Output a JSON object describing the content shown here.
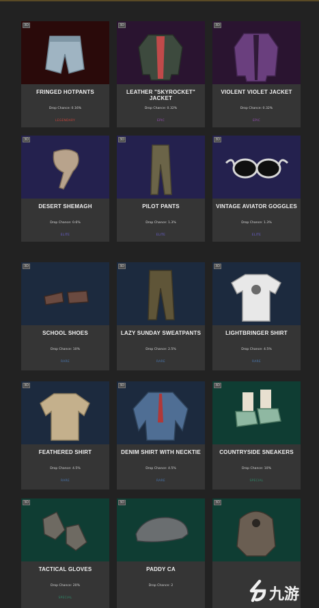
{
  "page": {
    "badge_text": "3D",
    "drop_label": "Drop Chance:"
  },
  "items": [
    {
      "name": "FRINGED HOTPANTS",
      "drop": "0.16%",
      "rarity": "LEGENDARY",
      "rarity_color": "#c8433a",
      "bg": "#2a0a0a",
      "icon": "hotpants-icon"
    },
    {
      "name": "LEATHER \"SKYROCKET\" JACKET",
      "drop": "0.32%",
      "rarity": "EPIC",
      "rarity_color": "#9a4fb8",
      "bg": "#2a1430",
      "icon": "leather-jacket-icon"
    },
    {
      "name": "VIOLENT VIOLET JACKET",
      "drop": "0.32%",
      "rarity": "EPIC",
      "rarity_color": "#9a4fb8",
      "bg": "#2a1430",
      "icon": "violet-jacket-icon"
    },
    {
      "name": "DESERT SHEMAGH",
      "drop": "0.6%",
      "rarity": "ELITE",
      "rarity_color": "#6c62d6",
      "bg": "#24214e",
      "icon": "shemagh-icon"
    },
    {
      "name": "PILOT PANTS",
      "drop": "1.3%",
      "rarity": "ELITE",
      "rarity_color": "#6c62d6",
      "bg": "#24214e",
      "icon": "pilot-pants-icon"
    },
    {
      "name": "VINTAGE AVIATOR GOGGLES",
      "drop": "1.3%",
      "rarity": "ELITE",
      "rarity_color": "#6c62d6",
      "bg": "#24214e",
      "icon": "goggles-icon"
    },
    {
      "name": "SCHOOL SHOES",
      "drop": "10%",
      "rarity": "RARE",
      "rarity_color": "#4a77b0",
      "bg": "#1c2a3e",
      "icon": "shoes-icon"
    },
    {
      "name": "LAZY SUNDAY SWEATPANTS",
      "drop": "2.5%",
      "rarity": "RARE",
      "rarity_color": "#4a77b0",
      "bg": "#1c2a3e",
      "icon": "sweatpants-icon"
    },
    {
      "name": "LIGHTBRINGER SHIRT",
      "drop": "4.5%",
      "rarity": "RARE",
      "rarity_color": "#4a77b0",
      "bg": "#1c2a3e",
      "icon": "tshirt-icon"
    },
    {
      "name": "FEATHERED SHIRT",
      "drop": "4.5%",
      "rarity": "RARE",
      "rarity_color": "#4a77b0",
      "bg": "#1c2a3e",
      "icon": "feathered-shirt-icon"
    },
    {
      "name": "DENIM SHIRT WITH NECKTIE",
      "drop": "4.5%",
      "rarity": "RARE",
      "rarity_color": "#4a77b0",
      "bg": "#1c2a3e",
      "icon": "denim-shirt-icon"
    },
    {
      "name": "COUNTRYSIDE SNEAKERS",
      "drop": "10%",
      "rarity": "SPECIAL",
      "rarity_color": "#2f8a6a",
      "bg": "#0f3d33",
      "icon": "sneakers-icon"
    },
    {
      "name": "TACTICAL GLOVES",
      "drop": "20%",
      "rarity": "SPECIAL",
      "rarity_color": "#2f8a6a",
      "bg": "#0f3d33",
      "icon": "gloves-icon"
    },
    {
      "name": "PADDY CA",
      "drop": "2",
      "rarity": "",
      "rarity_color": "#2f8a6a",
      "bg": "#0f3d33",
      "icon": "flat-cap-icon"
    },
    {
      "name": "",
      "drop": "",
      "rarity": "",
      "rarity_color": "#2f8a6a",
      "bg": "#0f3d33",
      "icon": "aviator-hat-icon"
    }
  ],
  "watermark": {
    "text": "九游",
    "icon": "jiuyou-logo-icon"
  }
}
